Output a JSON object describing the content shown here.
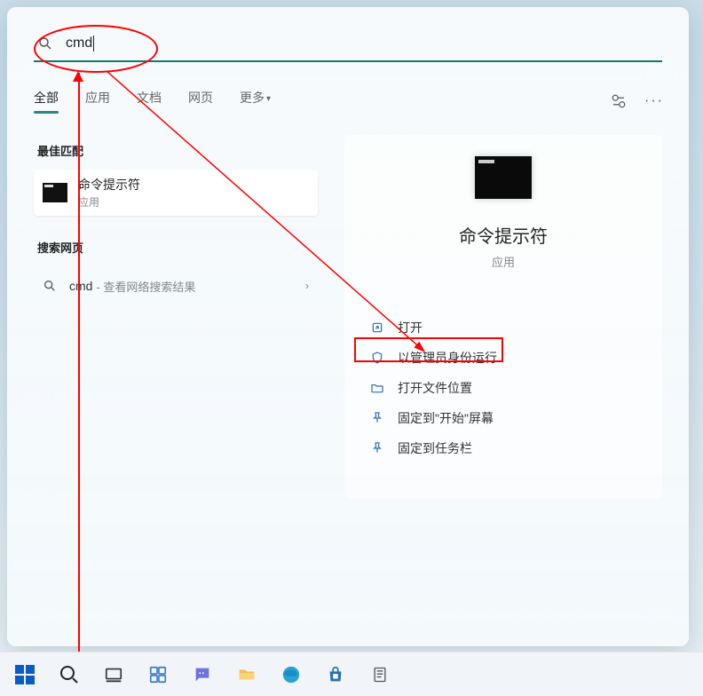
{
  "search": {
    "query": "cmd"
  },
  "tabs": {
    "all": "全部",
    "apps": "应用",
    "docs": "文档",
    "web": "网页",
    "more": "更多"
  },
  "left": {
    "best_match_title": "最佳匹配",
    "best": {
      "name": "命令提示符",
      "type": "应用"
    },
    "search_web_title": "搜索网页",
    "web": {
      "query": "cmd",
      "hint": "- 查看网络搜索结果"
    }
  },
  "right": {
    "app_name": "命令提示符",
    "app_type": "应用",
    "actions": {
      "open": "打开",
      "run_as_admin": "以管理员身份运行",
      "open_location": "打开文件位置",
      "pin_start": "固定到\"开始\"屏幕",
      "pin_taskbar": "固定到任务栏"
    }
  }
}
